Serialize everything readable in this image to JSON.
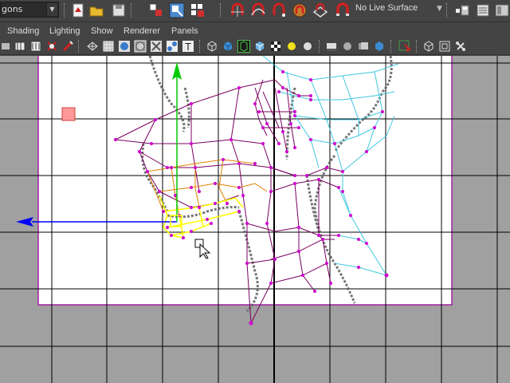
{
  "status_line": {
    "mode_select": {
      "value": "gons"
    },
    "live_surface": {
      "label": "No Live Surface"
    },
    "icons": [
      "new-scene-icon",
      "open-scene-icon",
      "save-scene-icon",
      "select-by-hierarchy-icon",
      "select-by-object-icon",
      "select-by-component-icon",
      "snap-to-grid-icon",
      "snap-to-curve-icon",
      "snap-to-point-icon",
      "snap-to-view-plane-icon",
      "make-live-icon",
      "magnet-icon",
      "render-view-icon",
      "render-settings-icon"
    ]
  },
  "panel_menu": {
    "items": [
      {
        "id": "shading",
        "label": "Shading"
      },
      {
        "id": "lighting",
        "label": "Lighting"
      },
      {
        "id": "show",
        "label": "Show"
      },
      {
        "id": "renderer",
        "label": "Renderer"
      },
      {
        "id": "panels",
        "label": "Panels"
      }
    ]
  },
  "colors": {
    "toolbar_bg": "#444444",
    "viewport_bg": "#a0a0a0",
    "image_plane": "#ffffff",
    "image_plane_border": "#a020a0",
    "mesh_selected": "#ffff00",
    "mesh_orange": "#e08000",
    "mesh_purple": "#7a0060",
    "mesh_cyan": "#40c8e0",
    "vertex": "#d000d0",
    "manip_x": "#0000ff",
    "manip_y": "#00cc00",
    "move_handle": "#ff9999"
  }
}
